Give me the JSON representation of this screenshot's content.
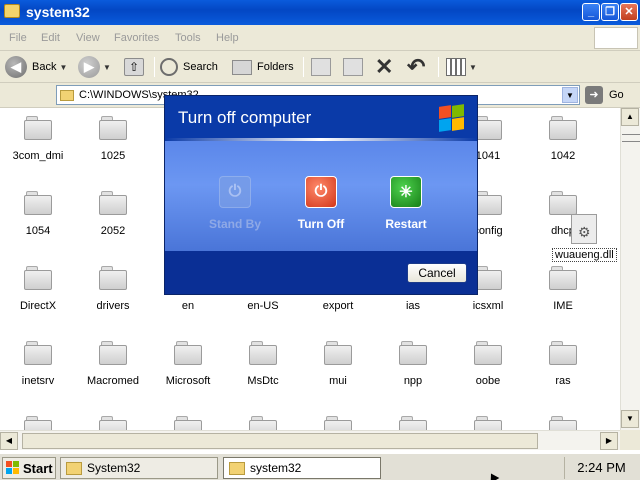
{
  "window": {
    "title": "system32"
  },
  "title_buttons": {
    "minimize": "_",
    "maximize": "❐",
    "close": "✕"
  },
  "menu": [
    "File",
    "Edit",
    "View",
    "Favorites",
    "Tools",
    "Help"
  ],
  "toolbar": {
    "back_label": "Back",
    "search_label": "Search",
    "folders_label": "Folders"
  },
  "address": {
    "value": "C:\\WINDOWS\\system32",
    "go_label": "Go"
  },
  "items_row1": [
    "3com_dmi",
    "1025",
    "",
    "",
    "",
    "",
    "1041",
    "1042"
  ],
  "items_row2": [
    "1054",
    "2052",
    "",
    "",
    "",
    "",
    "config",
    "dhcp"
  ],
  "items_row3": [
    "DirectX",
    "drivers",
    "en",
    "en-US",
    "export",
    "ias",
    "icsxml",
    "IME"
  ],
  "items_row4": [
    "inetsrv",
    "Macromed",
    "Microsoft",
    "MsDtc",
    "mui",
    "npp",
    "oobe",
    "ras"
  ],
  "drag_file": {
    "label": "wuaueng.dll",
    "icon": "dll-file-icon"
  },
  "dialog": {
    "title": "Turn off computer",
    "options": [
      {
        "label": "Stand By",
        "icon": "standby-icon",
        "enabled": false
      },
      {
        "label": "Turn Off",
        "icon": "power-icon",
        "enabled": true
      },
      {
        "label": "Restart",
        "icon": "restart-icon",
        "enabled": true
      }
    ],
    "cancel_label": "Cancel"
  },
  "taskbar": {
    "start_label": "Start",
    "tasks": [
      {
        "label": "System32",
        "active": false
      },
      {
        "label": "system32",
        "active": true
      }
    ],
    "clock": "2:24 PM"
  },
  "colors": {
    "titlebar": "#0a5bdc",
    "dialog_body": "#6c97f2",
    "turnoff": "#d2361a",
    "restart": "#177f17"
  }
}
